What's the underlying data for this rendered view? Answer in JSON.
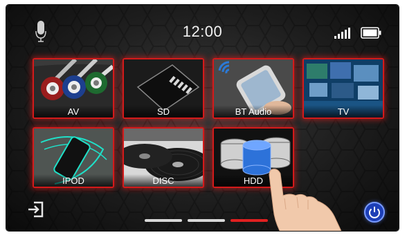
{
  "status_bar": {
    "time": "12:00",
    "icons": [
      "microphone-icon",
      "signal-icon",
      "battery-icon"
    ]
  },
  "tiles": [
    {
      "label": "AV",
      "icon": "rca-cables-image"
    },
    {
      "label": "SD",
      "icon": "sd-card-image"
    },
    {
      "label": "BT Audio",
      "icon": "phone-bluetooth-image"
    },
    {
      "label": "TV",
      "icon": "tv-screens-image"
    },
    {
      "label": "IPOD",
      "icon": "ipod-image"
    },
    {
      "label": "DISC",
      "icon": "disc-image"
    },
    {
      "label": "HDD",
      "icon": "database-image"
    }
  ],
  "pager": {
    "pages": 3,
    "active_index": 2
  },
  "bottom": {
    "left_icon": "exit-icon",
    "right_icon": "power-icon"
  },
  "colors": {
    "accent": "#d41a1a",
    "power": "#1d3fb7",
    "text": "#ffffff"
  }
}
